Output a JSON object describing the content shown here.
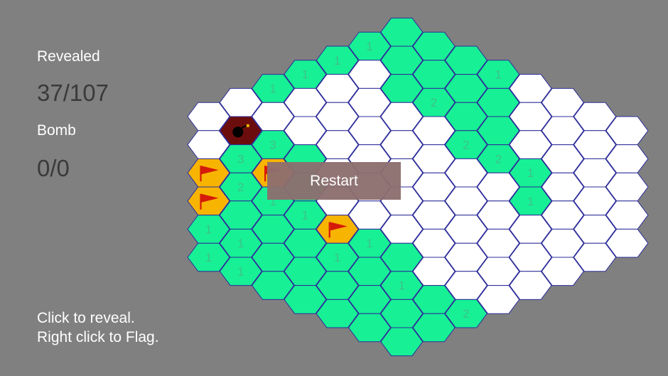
{
  "panel": {
    "revealed_label": "Revealed",
    "revealed_value": "37/107",
    "bomb_label": "Bomb",
    "bomb_value": "0/0",
    "help_line1": "Click to reveal.",
    "help_line2": "Right click to Flag."
  },
  "restart_button": {
    "label": "Restart"
  },
  "colors": {
    "background": "#808080",
    "hidden_cell": "#ffffff",
    "revealed_cell": "#17f095",
    "flag_cell": "#f7b400",
    "bomb_cell": "#6b0d0d",
    "cell_border": "#2c2c9a",
    "number_text": "#3fc08b",
    "flag_red": "#d61a0a"
  },
  "board": {
    "columns": 14,
    "rows_per_column": [
      6,
      7,
      8,
      9,
      10,
      11,
      12,
      11,
      10,
      9,
      8,
      7,
      6,
      5
    ],
    "cells": [
      "H",
      "H",
      "F",
      "F",
      "R1",
      "R1",
      "H",
      "B",
      "R3",
      "R2",
      "R",
      "R1",
      "R1",
      "R1",
      "H",
      "R3",
      "F",
      "R1",
      "R",
      "R",
      "R",
      "R1",
      "H",
      "H",
      "R",
      "R2",
      "R1",
      "R",
      "R",
      "R",
      "R1",
      "H",
      "H",
      "H",
      "H",
      "H",
      "F",
      "R1",
      "R",
      "R",
      "R1",
      "H",
      "H",
      "H",
      "H",
      "H",
      "H",
      "R1",
      "R",
      "R",
      "R",
      "R",
      "R",
      "R",
      "H",
      "H",
      "H",
      "H",
      "H",
      "R",
      "R1",
      "R",
      "R",
      "R",
      "R",
      "R2",
      "H",
      "H",
      "H",
      "H",
      "H",
      "H",
      "R",
      "R",
      "R",
      "R",
      "R",
      "R2",
      "H",
      "H",
      "H",
      "H",
      "H",
      "R2",
      "R1",
      "R",
      "R",
      "R2",
      "H",
      "H",
      "H",
      "H",
      "H",
      "H",
      "H",
      "H",
      "R1",
      "R1",
      "H",
      "H",
      "H",
      "H",
      "H",
      "H",
      "H",
      "H",
      "H",
      "H",
      "H",
      "H",
      "H",
      "H",
      "H",
      "H",
      "H",
      "H",
      "H",
      "H",
      "H",
      "H",
      "H",
      "H",
      "H",
      "H",
      "H",
      "H",
      "H",
      "H",
      "H",
      "H"
    ]
  }
}
